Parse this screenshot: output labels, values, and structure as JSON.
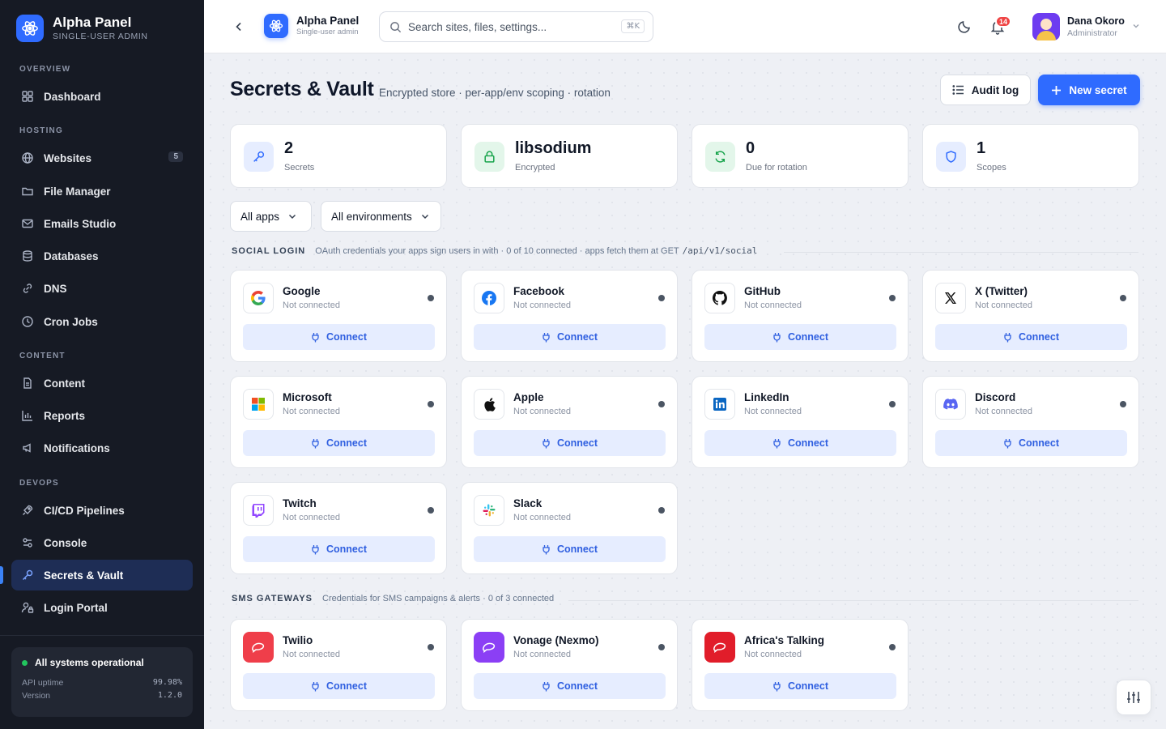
{
  "brand": {
    "title": "Alpha Panel",
    "subtitle": "SINGLE-USER ADMIN"
  },
  "sidebar": {
    "sections": {
      "overview": "OVERVIEW",
      "hosting": "HOSTING",
      "content": "CONTENT",
      "devops": "DEVOPS"
    },
    "items": [
      {
        "label": "Dashboard",
        "icon": "grid-icon"
      },
      {
        "label": "Websites",
        "icon": "globe-icon",
        "badge": "5"
      },
      {
        "label": "File Manager",
        "icon": "folder-icon"
      },
      {
        "label": "Emails Studio",
        "icon": "mail-icon"
      },
      {
        "label": "Databases",
        "icon": "database-icon"
      },
      {
        "label": "DNS",
        "icon": "link-icon"
      },
      {
        "label": "Cron Jobs",
        "icon": "clock-icon"
      },
      {
        "label": "Content",
        "icon": "document-icon"
      },
      {
        "label": "Reports",
        "icon": "bar-chart-icon"
      },
      {
        "label": "Notifications",
        "icon": "megaphone-icon"
      },
      {
        "label": "CI/CD Pipelines",
        "icon": "rocket-icon"
      },
      {
        "label": "Console",
        "icon": "console-icon"
      },
      {
        "label": "Secrets & Vault",
        "icon": "key-icon",
        "active": true
      },
      {
        "label": "Login Portal",
        "icon": "user-lock-icon"
      }
    ],
    "status": {
      "title": "All systems operational",
      "uptime_label": "API uptime",
      "uptime_value": "99.98%",
      "version_label": "Version",
      "version_value": "1.2.0"
    }
  },
  "topbar": {
    "app_title": "Alpha Panel",
    "app_subtitle": "Single-user admin",
    "search_placeholder": "Search sites, files, settings...",
    "search_shortcut": "⌘K",
    "notification_count": "14",
    "user_name": "Dana Okoro",
    "user_role": "Administrator"
  },
  "page": {
    "title": "Secrets & Vault",
    "subtitle": "Encrypted store · per-app/env scoping · rotation",
    "audit_label": "Audit log",
    "new_label": "New secret"
  },
  "stats": [
    {
      "value": "2",
      "label": "Secrets",
      "icon": "key-icon",
      "color": "#2f6bff"
    },
    {
      "value": "libsodium",
      "label": "Encrypted",
      "icon": "lock-icon",
      "color": "#16a34a"
    },
    {
      "value": "0",
      "label": "Due for rotation",
      "icon": "refresh-icon",
      "color": "#16a34a"
    },
    {
      "value": "1",
      "label": "Scopes",
      "icon": "shield-icon",
      "color": "#2f6bff"
    }
  ],
  "filters": {
    "apps": "All apps",
    "envs": "All environments"
  },
  "social": {
    "title": "SOCIAL LOGIN",
    "desc": "OAuth credentials your apps sign users in with · 0 of 10 connected · apps fetch them at GET",
    "endpoint": "/api/v1/social",
    "providers": [
      {
        "name": "Google",
        "status": "Not connected",
        "action": "Connect"
      },
      {
        "name": "Facebook",
        "status": "Not connected",
        "action": "Connect"
      },
      {
        "name": "GitHub",
        "status": "Not connected",
        "action": "Connect"
      },
      {
        "name": "X (Twitter)",
        "status": "Not connected",
        "action": "Connect"
      },
      {
        "name": "Microsoft",
        "status": "Not connected",
        "action": "Connect"
      },
      {
        "name": "Apple",
        "status": "Not connected",
        "action": "Connect"
      },
      {
        "name": "LinkedIn",
        "status": "Not connected",
        "action": "Connect"
      },
      {
        "name": "Discord",
        "status": "Not connected",
        "action": "Connect"
      },
      {
        "name": "Twitch",
        "status": "Not connected",
        "action": "Connect"
      },
      {
        "name": "Slack",
        "status": "Not connected",
        "action": "Connect"
      }
    ]
  },
  "sms": {
    "title": "SMS GATEWAYS",
    "desc": "Credentials for SMS campaigns & alerts · 0 of 3 connected",
    "providers": [
      {
        "name": "Twilio",
        "status": "Not connected",
        "action": "Connect",
        "color": "#ef3e4a"
      },
      {
        "name": "Vonage (Nexmo)",
        "status": "Not connected",
        "action": "Connect",
        "color": "#8b3ff5"
      },
      {
        "name": "Africa's Talking",
        "status": "Not connected",
        "action": "Connect",
        "color": "#e11d2a"
      }
    ]
  }
}
